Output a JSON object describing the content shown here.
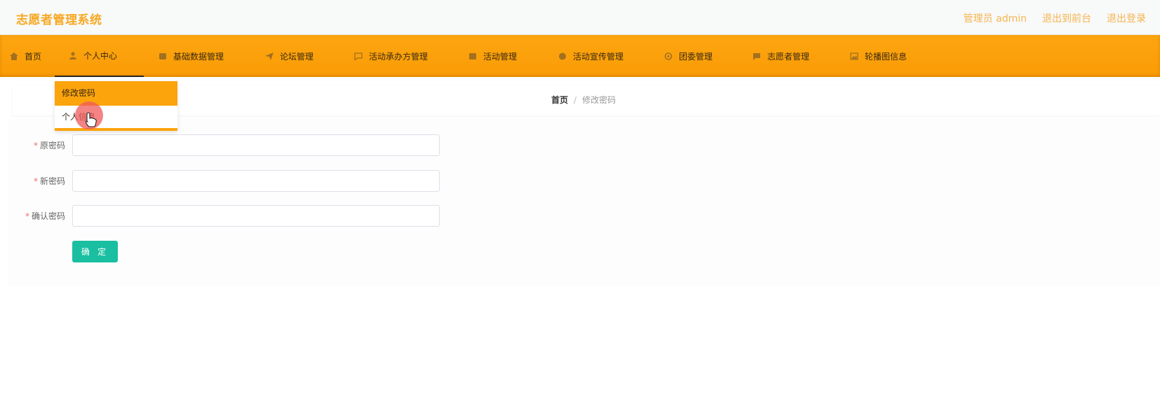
{
  "header": {
    "title": "志愿者管理系统",
    "links": [
      "管理员 admin",
      "退出到前台",
      "退出登录"
    ]
  },
  "nav": {
    "items": [
      {
        "label": "首页",
        "icon": "home-icon"
      },
      {
        "label": "个人中心",
        "icon": "user-icon"
      },
      {
        "label": "基础数据管理",
        "icon": "database-icon"
      },
      {
        "label": "论坛管理",
        "icon": "send-icon"
      },
      {
        "label": "活动承办方管理",
        "icon": "chat-icon"
      },
      {
        "label": "活动管理",
        "icon": "calendar-icon"
      },
      {
        "label": "活动宣传管理",
        "icon": "circle-icon"
      },
      {
        "label": "团委管理",
        "icon": "gear-icon"
      },
      {
        "label": "志愿者管理",
        "icon": "message-icon"
      },
      {
        "label": "轮播图信息",
        "icon": "image-icon"
      }
    ],
    "dropdown": [
      "修改密码",
      "个人信息"
    ]
  },
  "breadcrumb": {
    "home": "首页",
    "separator": "/",
    "current": "修改密码"
  },
  "form": {
    "fields": [
      {
        "label": "原密码",
        "value": ""
      },
      {
        "label": "新密码",
        "value": ""
      },
      {
        "label": "确认密码",
        "value": ""
      }
    ],
    "required_mark": "*",
    "submit_label": "确 定"
  },
  "colors": {
    "accent": "#fba40c",
    "title": "#f7a823",
    "submit": "#19bfa0",
    "required": "#f56c6c"
  }
}
